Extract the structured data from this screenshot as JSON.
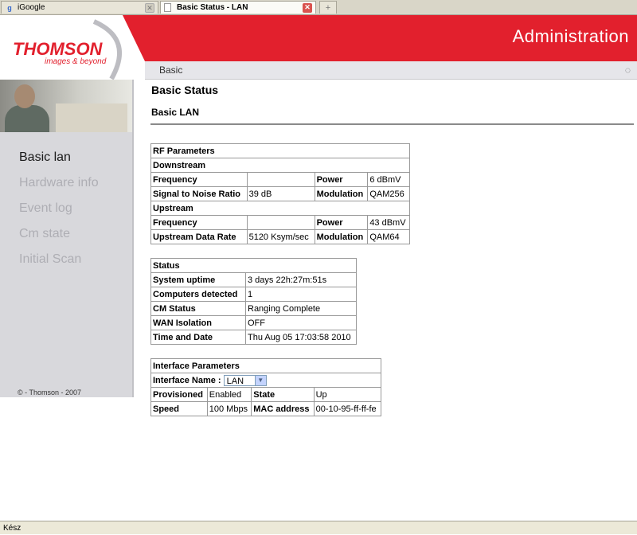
{
  "browser": {
    "tabs": [
      {
        "label": "iGoogle",
        "icon": "google-icon"
      },
      {
        "label": "Basic Status - LAN",
        "icon": "page-icon"
      }
    ],
    "new_tab_symbol": "+",
    "status_text": "Kész"
  },
  "header": {
    "brand": "THOMSON",
    "tagline": "images & beyond",
    "title": "Administration",
    "tab": "Basic"
  },
  "sidebar": {
    "items": [
      {
        "label": "Basic lan",
        "active": true
      },
      {
        "label": "Hardware info"
      },
      {
        "label": "Event log"
      },
      {
        "label": "Cm state"
      },
      {
        "label": "Initial Scan"
      }
    ],
    "copyright": "© - Thomson - 2007"
  },
  "main": {
    "page_title": "Basic Status",
    "section_title": "Basic LAN"
  },
  "rf": {
    "title": "RF Parameters",
    "downstream": {
      "label": "Downstream",
      "frequency_label": "Frequency",
      "frequency_value": "",
      "power_label": "Power",
      "power_value": "6 dBmV",
      "snr_label": "Signal to Noise Ratio",
      "snr_value": "39 dB",
      "modulation_label": "Modulation",
      "modulation_value": "QAM256"
    },
    "upstream": {
      "label": "Upstream",
      "frequency_label": "Frequency",
      "frequency_value": "",
      "power_label": "Power",
      "power_value": "43 dBmV",
      "rate_label": "Upstream Data Rate",
      "rate_value": "5120 Ksym/sec",
      "modulation_label": "Modulation",
      "modulation_value": "QAM64"
    }
  },
  "status": {
    "title": "Status",
    "rows": [
      {
        "label": "System uptime",
        "value": "3 days 22h:27m:51s"
      },
      {
        "label": "Computers detected",
        "value": "1"
      },
      {
        "label": "CM Status",
        "value": "Ranging Complete"
      },
      {
        "label": "WAN Isolation",
        "value": "OFF"
      },
      {
        "label": "Time and Date",
        "value": "Thu Aug 05 17:03:58 2010"
      }
    ]
  },
  "interface": {
    "title": "Interface Parameters",
    "name_label": "Interface Name :",
    "name_value": "LAN",
    "provisioned_label": "Provisioned",
    "provisioned_value": "Enabled",
    "state_label": "State",
    "state_value": "Up",
    "speed_label": "Speed",
    "speed_value": "100 Mbps",
    "mac_label": "MAC address",
    "mac_value": "00-10-95-ff-ff-fe"
  },
  "colors": {
    "brand_red": "#e2202d",
    "sidebar_bg": "#d8d8dc"
  }
}
